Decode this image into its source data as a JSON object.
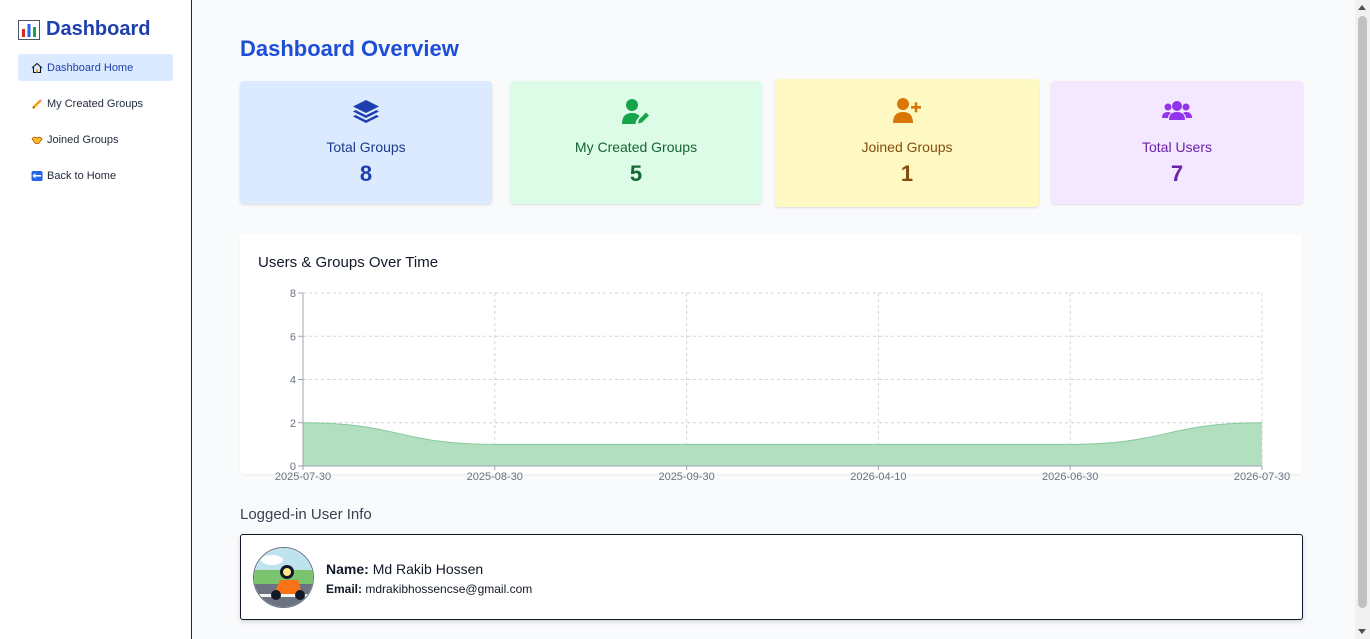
{
  "sidebar": {
    "title": "Dashboard",
    "items": [
      {
        "label": "Dashboard Home",
        "icon": "house-icon"
      },
      {
        "label": "My Created Groups",
        "icon": "pencil-icon"
      },
      {
        "label": "Joined Groups",
        "icon": "handshake-icon"
      },
      {
        "label": "Back to Home",
        "icon": "back-icon"
      }
    ]
  },
  "main": {
    "title": "Dashboard Overview",
    "cards": [
      {
        "label": "Total Groups",
        "value": "8",
        "icon": "layers-icon",
        "bg": "#dbeafe",
        "color": "#1e40af"
      },
      {
        "label": "My Created Groups",
        "value": "5",
        "icon": "user-edit-icon",
        "bg": "#dcfce7",
        "color": "#166534"
      },
      {
        "label": "Joined Groups",
        "value": "1",
        "icon": "user-plus-icon",
        "bg": "#fef9c3",
        "color": "#854d0e"
      },
      {
        "label": "Total Users",
        "value": "7",
        "icon": "users-icon",
        "bg": "#f3e8ff",
        "color": "#6b21a8"
      }
    ]
  },
  "chart_data": {
    "type": "area",
    "title": "Users & Groups Over Time",
    "categories": [
      "2025-07-30",
      "2025-08-30",
      "2025-09-30",
      "2026-04-10",
      "2026-06-30",
      "2026-07-30"
    ],
    "series": [
      {
        "values": [
          2,
          1,
          1,
          1,
          1,
          2
        ]
      }
    ],
    "ylim": [
      0,
      8
    ],
    "yticks": [
      0,
      2,
      4,
      6,
      8
    ],
    "grid": true,
    "fill_color": "#b3dfc1",
    "line_color": "#86c99b"
  },
  "user": {
    "section_title": "Logged-in User Info",
    "name_label": "Name:",
    "name": "Md Rakib Hossen",
    "email_label": "Email:",
    "email": "mdrakibhossencse@gmail.com"
  }
}
